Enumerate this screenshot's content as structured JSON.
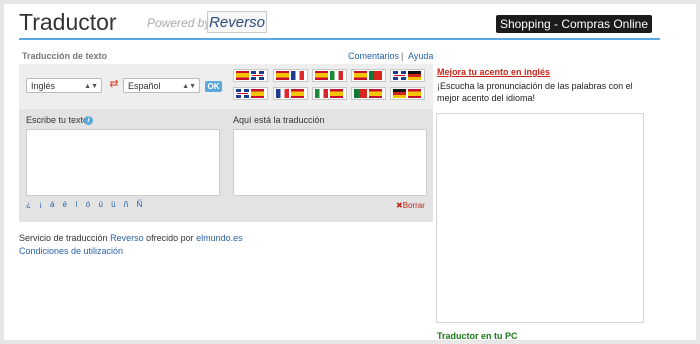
{
  "header": {
    "title": "Traductor",
    "powered_by": "Powered by",
    "brand": "Reverso",
    "shop_button": "Shopping - Compras Online »"
  },
  "translator": {
    "section_label": "Traducción de texto",
    "links": [
      "Comentarios",
      "Ayuda"
    ],
    "link_separator": "|",
    "source_language": "Inglés",
    "target_language": "Español",
    "ok_label": "OK",
    "quick_pairs": [
      [
        "es",
        "gb"
      ],
      [
        "es",
        "fr"
      ],
      [
        "es",
        "it"
      ],
      [
        "es",
        "pt"
      ],
      [
        "gb",
        "de"
      ],
      [
        "gb",
        "es"
      ],
      [
        "fr",
        "es"
      ],
      [
        "it",
        "es"
      ],
      [
        "pt",
        "es"
      ],
      [
        "de",
        "es"
      ]
    ],
    "input_label": "Escribe tu texto",
    "output_label": "Aquí está la traducción",
    "special_chars": "¿ ¡ á é í ó ú ü ñ Ñ",
    "clear_label": "Borrar"
  },
  "footer": {
    "service_prefix": "Servicio de traducción",
    "service_brand": "Reverso",
    "service_mid": "ofrecido por",
    "service_site": "elmundo.es",
    "conditions": "Condiciones de utilización"
  },
  "sidebar": {
    "accent_title": "Mejora tu acento en inglés",
    "accent_text": "¡Escucha la pronunciación de las palabras con el mejor acento del idioma!",
    "pc_title": "Traductor en tu PC"
  },
  "colors": {
    "accent_blue": "#5aa9de",
    "link_blue": "#2862a8",
    "red": "#c9261a",
    "green": "#1a7a1a"
  }
}
